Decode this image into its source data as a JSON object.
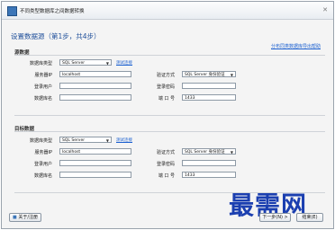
{
  "window": {
    "title": "不同类型数据库之间数据转换"
  },
  "header": {
    "step_title": "设置数据源（第1步，共4步）",
    "help_link": "分布同类数据库导出帮助"
  },
  "source": {
    "section_label": "源数据",
    "db_type_label": "数据库类型",
    "db_type_value": "SQL Server",
    "test_link": "测试连接",
    "server_ip_label": "服务器IP",
    "server_ip_value": "localhost",
    "auth_label": "验证方式",
    "auth_value": "SQL Server 身份验证",
    "login_user_label": "登录用户",
    "login_user_value": "",
    "login_pwd_label": "登录密码",
    "login_pwd_value": "",
    "db_name_label": "数据库名",
    "db_name_value": "",
    "port_label": "端 口 号",
    "port_value": "1433"
  },
  "target": {
    "section_label": "目标数据",
    "db_type_label": "数据库类型",
    "db_type_value": "SQL Server",
    "test_link": "测试连接",
    "server_ip_label": "服务器IP",
    "server_ip_value": "localhost",
    "auth_label": "验证方式",
    "auth_value": "SQL Server 身份验证",
    "login_user_label": "登录用户",
    "login_user_value": "",
    "login_pwd_label": "登录密码",
    "login_pwd_value": "",
    "db_name_label": "数据库名",
    "db_name_value": "",
    "port_label": "端 口 号",
    "port_value": "1433"
  },
  "footer": {
    "about_label": "关于/注册",
    "next_label": "下一步(N) >",
    "finish_label": "结束(E)"
  },
  "watermark": "最需网",
  "colors": {
    "accent": "#1f4f9a",
    "link": "#1a5fd0",
    "watermark": "#1b3fb0"
  }
}
